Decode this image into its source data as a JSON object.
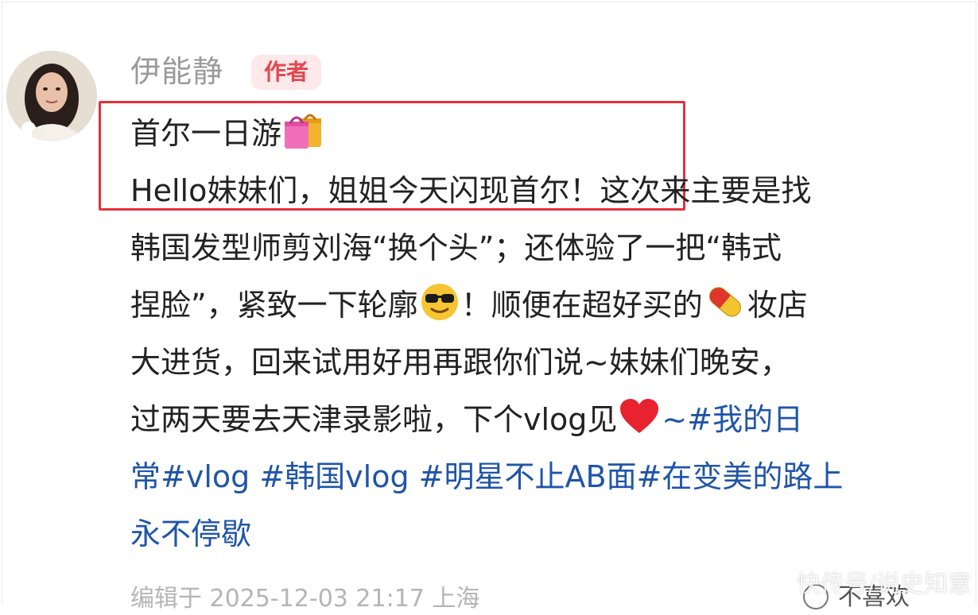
{
  "post": {
    "author_name": "伊能静",
    "author_badge": "作者",
    "lines": [
      {
        "text": "首尔一日游",
        "emoji_after": "shopping-bags-icon"
      },
      {
        "text": "Hello妹妹们，姐姐今天闪现首尔！这次来主要是找"
      },
      {
        "text": "韩国发型师剪刘海“换个头”；还体验了一把“韩式"
      },
      {
        "part1": "捏脸”，紧致一下轮廓",
        "part2": "！顺便在超好买的",
        "part3": "妆店"
      },
      {
        "text": "大进货，回来试用好用再跟你们说~妹妹们晚安，"
      },
      {
        "part1": "过两天要去天津录影啦，下个vlog见",
        "part2": "~#我的日"
      },
      {
        "text": "常#vlog #韩国vlog #明星不止AB面#在变美的路上"
      },
      {
        "text": "永不停歇"
      }
    ],
    "footer": {
      "meta": "编辑于 2025-12-03 21:17 上海",
      "dislike_label": "不喜欢"
    }
  },
  "watermark": "快传号/说史知意",
  "icons": [
    "avatar-photo",
    "shopping-bags-icon",
    "sunglasses-emoji-icon",
    "pill-emoji-icon",
    "red-heart-emoji-icon",
    "dislike-icon"
  ],
  "colors": {
    "highlight": "#e2323b",
    "badge_bg": "#fde9ea",
    "badge_text": "#e3474f",
    "author_name": "#9a9a9a",
    "hashtag": "#1f55a8",
    "body_text": "#222222"
  }
}
